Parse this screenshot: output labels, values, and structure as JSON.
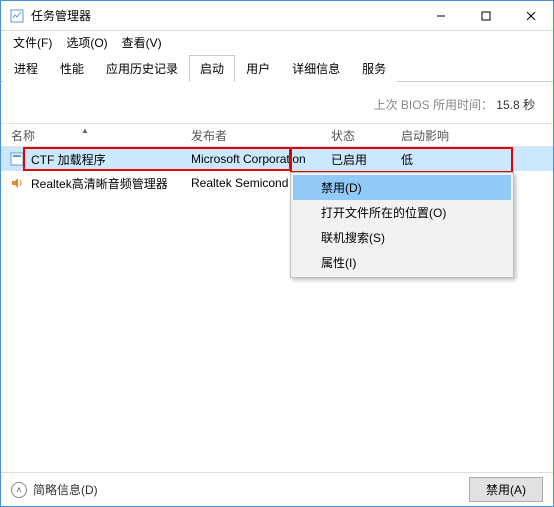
{
  "window": {
    "title": "任务管理器"
  },
  "menubar": {
    "file": "文件(F)",
    "options": "选项(O)",
    "view": "查看(V)"
  },
  "tabs": {
    "processes": "进程",
    "performance": "性能",
    "history": "应用历史记录",
    "startup": "启动",
    "users": "用户",
    "details": "详细信息",
    "services": "服务"
  },
  "bios": {
    "label": "上次 BIOS 所用时间：",
    "value": "15.8 秒"
  },
  "columns": {
    "name": "名称",
    "publisher": "发布者",
    "status": "状态",
    "impact": "启动影响"
  },
  "rows": [
    {
      "name": "CTF 加载程序",
      "publisher": "Microsoft Corporation",
      "status": "已启用",
      "impact": "低"
    },
    {
      "name": "Realtek高清晰音频管理器",
      "publisher": "Realtek Semicond",
      "status": "",
      "impact": ""
    }
  ],
  "context_menu": {
    "disable": "禁用(D)",
    "open_location": "打开文件所在的位置(O)",
    "search_online": "联机搜索(S)",
    "properties": "属性(I)"
  },
  "footer": {
    "fewer_details": "简略信息(D)",
    "disable_button": "禁用(A)"
  }
}
